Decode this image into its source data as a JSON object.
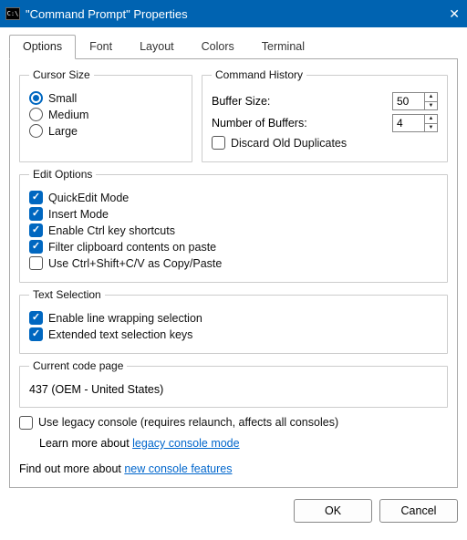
{
  "title": "\"Command Prompt\" Properties",
  "tabs": [
    "Options",
    "Font",
    "Layout",
    "Colors",
    "Terminal"
  ],
  "activeTab": 0,
  "cursor": {
    "legend": "Cursor Size",
    "options": [
      "Small",
      "Medium",
      "Large"
    ],
    "selected": 0
  },
  "history": {
    "legend": "Command History",
    "bufferLabel": "Buffer Size:",
    "bufferValue": "50",
    "numBuffersLabel": "Number of Buffers:",
    "numBuffersValue": "4",
    "discardLabel": "Discard Old Duplicates",
    "discardChecked": false
  },
  "edit": {
    "legend": "Edit Options",
    "items": [
      {
        "label": "QuickEdit Mode",
        "checked": true
      },
      {
        "label": "Insert Mode",
        "checked": true
      },
      {
        "label": "Enable Ctrl key shortcuts",
        "checked": true
      },
      {
        "label": "Filter clipboard contents on paste",
        "checked": true
      },
      {
        "label": "Use Ctrl+Shift+C/V as Copy/Paste",
        "checked": false
      }
    ]
  },
  "textsel": {
    "legend": "Text Selection",
    "items": [
      {
        "label": "Enable line wrapping selection",
        "checked": true
      },
      {
        "label": "Extended text selection keys",
        "checked": true
      }
    ]
  },
  "codepage": {
    "legend": "Current code page",
    "value": "437  (OEM - United States)"
  },
  "legacy": {
    "label": "Use legacy console (requires relaunch, affects all consoles)",
    "checked": false,
    "learnPrefix": "Learn more about ",
    "learnLink": "legacy console mode"
  },
  "findout": {
    "prefix": "Find out more about ",
    "link": "new console features"
  },
  "buttons": {
    "ok": "OK",
    "cancel": "Cancel"
  }
}
